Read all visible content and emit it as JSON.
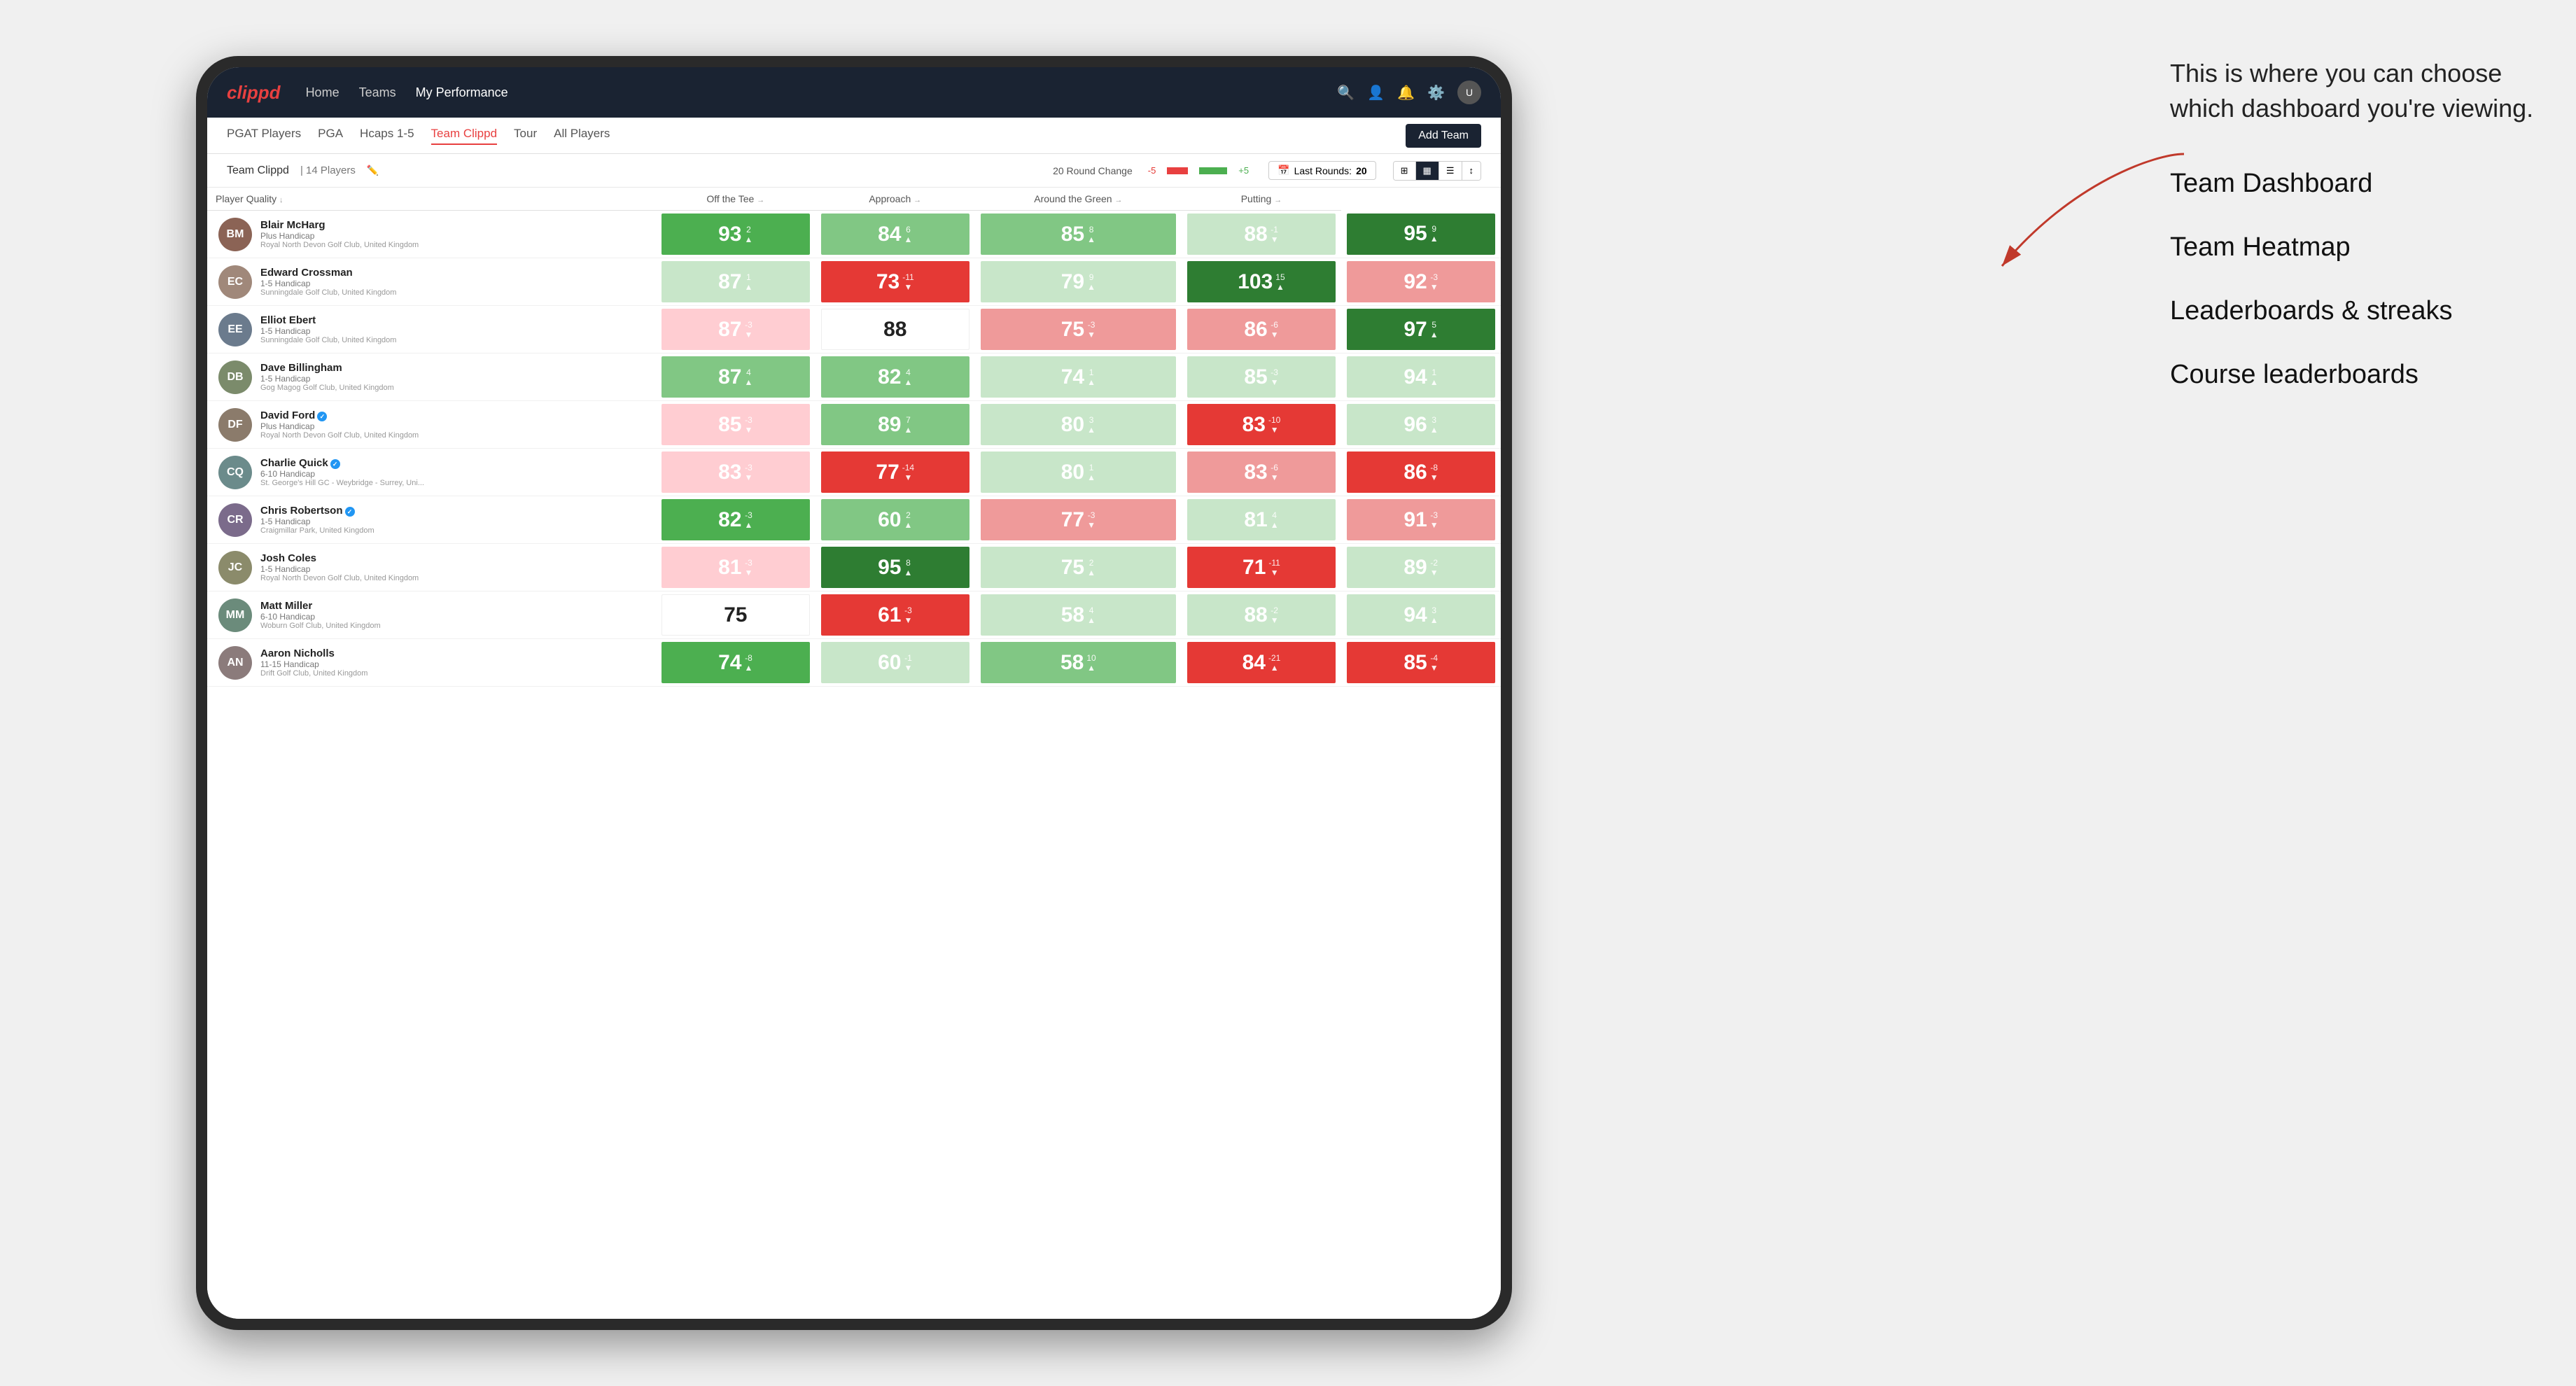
{
  "annotation": {
    "intro_text": "This is where you can choose which dashboard you're viewing.",
    "options": [
      "Team Dashboard",
      "Team Heatmap",
      "Leaderboards & streaks",
      "Course leaderboards"
    ]
  },
  "nav": {
    "logo": "clippd",
    "links": [
      "Home",
      "Teams",
      "My Performance"
    ],
    "active_link": "My Performance"
  },
  "sub_nav": {
    "tabs": [
      "PGAT Players",
      "PGA",
      "Hcaps 1-5",
      "Team Clippd",
      "Tour",
      "All Players"
    ],
    "active_tab": "Team Clippd",
    "add_team_label": "Add Team"
  },
  "team_header": {
    "team_name": "Team Clippd",
    "separator": "|",
    "player_count": "14 Players",
    "round_change_label": "20 Round Change",
    "round_change_neg": "-5",
    "round_change_pos": "+5",
    "last_rounds_label": "Last Rounds:",
    "last_rounds_value": "20"
  },
  "table": {
    "columns": [
      "Player Quality ↓",
      "Off the Tee →",
      "Approach →",
      "Around the Green →",
      "Putting →"
    ],
    "rows": [
      {
        "name": "Blair McHarg",
        "plus_handicap": "Plus Handicap",
        "club": "Royal North Devon Golf Club, United Kingdom",
        "scores": [
          {
            "value": 93,
            "change": "2▲",
            "color": "bg-green"
          },
          {
            "value": 84,
            "change": "6▲",
            "color": "bg-light-green"
          },
          {
            "value": 85,
            "change": "8▲",
            "color": "bg-light-green"
          },
          {
            "value": 88,
            "change": "-1▼",
            "color": "bg-pale-green"
          },
          {
            "value": 95,
            "change": "9▲",
            "color": "bg-dark-green"
          }
        ]
      },
      {
        "name": "Edward Crossman",
        "handicap": "1-5 Handicap",
        "club": "Sunningdale Golf Club, United Kingdom",
        "scores": [
          {
            "value": 87,
            "change": "1▲",
            "color": "bg-pale-green"
          },
          {
            "value": 73,
            "change": "-11▼",
            "color": "bg-red"
          },
          {
            "value": 79,
            "change": "9▲",
            "color": "bg-pale-green"
          },
          {
            "value": 103,
            "change": "15▲",
            "color": "bg-dark-green"
          },
          {
            "value": 92,
            "change": "-3▼",
            "color": "bg-light-red"
          }
        ]
      },
      {
        "name": "Elliot Ebert",
        "handicap": "1-5 Handicap",
        "club": "Sunningdale Golf Club, United Kingdom",
        "scores": [
          {
            "value": 87,
            "change": "-3▼",
            "color": "bg-pink"
          },
          {
            "value": 88,
            "change": "",
            "color": "bg-white"
          },
          {
            "value": 75,
            "change": "-3▼",
            "color": "bg-light-red"
          },
          {
            "value": 86,
            "change": "-6▼",
            "color": "bg-light-red"
          },
          {
            "value": 97,
            "change": "5▲",
            "color": "bg-dark-green"
          }
        ]
      },
      {
        "name": "Dave Billingham",
        "handicap": "1-5 Handicap",
        "club": "Gog Magog Golf Club, United Kingdom",
        "scores": [
          {
            "value": 87,
            "change": "4▲",
            "color": "bg-light-green"
          },
          {
            "value": 82,
            "change": "4▲",
            "color": "bg-light-green"
          },
          {
            "value": 74,
            "change": "1▲",
            "color": "bg-pale-green"
          },
          {
            "value": 85,
            "change": "-3▼",
            "color": "bg-pale-green"
          },
          {
            "value": 94,
            "change": "1▲",
            "color": "bg-pale-green"
          }
        ]
      },
      {
        "name": "David Ford",
        "handicap": "Plus Handicap",
        "club": "Royal North Devon Golf Club, United Kingdom",
        "verified": true,
        "scores": [
          {
            "value": 85,
            "change": "-3▼",
            "color": "bg-pink"
          },
          {
            "value": 89,
            "change": "7▲",
            "color": "bg-light-green"
          },
          {
            "value": 80,
            "change": "3▲",
            "color": "bg-pale-green"
          },
          {
            "value": 83,
            "change": "-10▼",
            "color": "bg-red"
          },
          {
            "value": 96,
            "change": "3▲",
            "color": "bg-pale-green"
          }
        ]
      },
      {
        "name": "Charlie Quick",
        "handicap": "6-10 Handicap",
        "club": "St. George's Hill GC - Weybridge - Surrey, Uni...",
        "verified": true,
        "scores": [
          {
            "value": 83,
            "change": "-3▼",
            "color": "bg-pink"
          },
          {
            "value": 77,
            "change": "-14▼",
            "color": "bg-red"
          },
          {
            "value": 80,
            "change": "1▲",
            "color": "bg-pale-green"
          },
          {
            "value": 83,
            "change": "-6▼",
            "color": "bg-light-red"
          },
          {
            "value": 86,
            "change": "-8▼",
            "color": "bg-red"
          }
        ]
      },
      {
        "name": "Chris Robertson",
        "handicap": "1-5 Handicap",
        "club": "Craigmillar Park, United Kingdom",
        "verified": true,
        "scores": [
          {
            "value": 82,
            "change": "-3▲",
            "color": "bg-green"
          },
          {
            "value": 60,
            "change": "2▲",
            "color": "bg-light-green"
          },
          {
            "value": 77,
            "change": "-3▼",
            "color": "bg-light-red"
          },
          {
            "value": 81,
            "change": "4▲",
            "color": "bg-pale-green"
          },
          {
            "value": 91,
            "change": "-3▼",
            "color": "bg-light-red"
          }
        ]
      },
      {
        "name": "Josh Coles",
        "handicap": "1-5 Handicap",
        "club": "Royal North Devon Golf Club, United Kingdom",
        "scores": [
          {
            "value": 81,
            "change": "-3▼",
            "color": "bg-pink"
          },
          {
            "value": 95,
            "change": "8▲",
            "color": "bg-dark-green"
          },
          {
            "value": 75,
            "change": "2▲",
            "color": "bg-pale-green"
          },
          {
            "value": 71,
            "change": "-11▼",
            "color": "bg-red"
          },
          {
            "value": 89,
            "change": "-2▼",
            "color": "bg-pale-green"
          }
        ]
      },
      {
        "name": "Matt Miller",
        "handicap": "6-10 Handicap",
        "club": "Woburn Golf Club, United Kingdom",
        "scores": [
          {
            "value": 75,
            "change": "",
            "color": "bg-white"
          },
          {
            "value": 61,
            "change": "-3▼",
            "color": "bg-red"
          },
          {
            "value": 58,
            "change": "4▲",
            "color": "bg-pale-green"
          },
          {
            "value": 88,
            "change": "-2▼",
            "color": "bg-pale-green"
          },
          {
            "value": 94,
            "change": "3▲",
            "color": "bg-pale-green"
          }
        ]
      },
      {
        "name": "Aaron Nicholls",
        "handicap": "11-15 Handicap",
        "club": "Drift Golf Club, United Kingdom",
        "scores": [
          {
            "value": 74,
            "change": "-8▲",
            "color": "bg-green"
          },
          {
            "value": 60,
            "change": "-1▼",
            "color": "bg-pale-green"
          },
          {
            "value": 58,
            "change": "10▲",
            "color": "bg-light-green"
          },
          {
            "value": 84,
            "change": "-21▲",
            "color": "bg-red"
          },
          {
            "value": 85,
            "change": "-4▼",
            "color": "bg-red"
          }
        ]
      }
    ]
  }
}
